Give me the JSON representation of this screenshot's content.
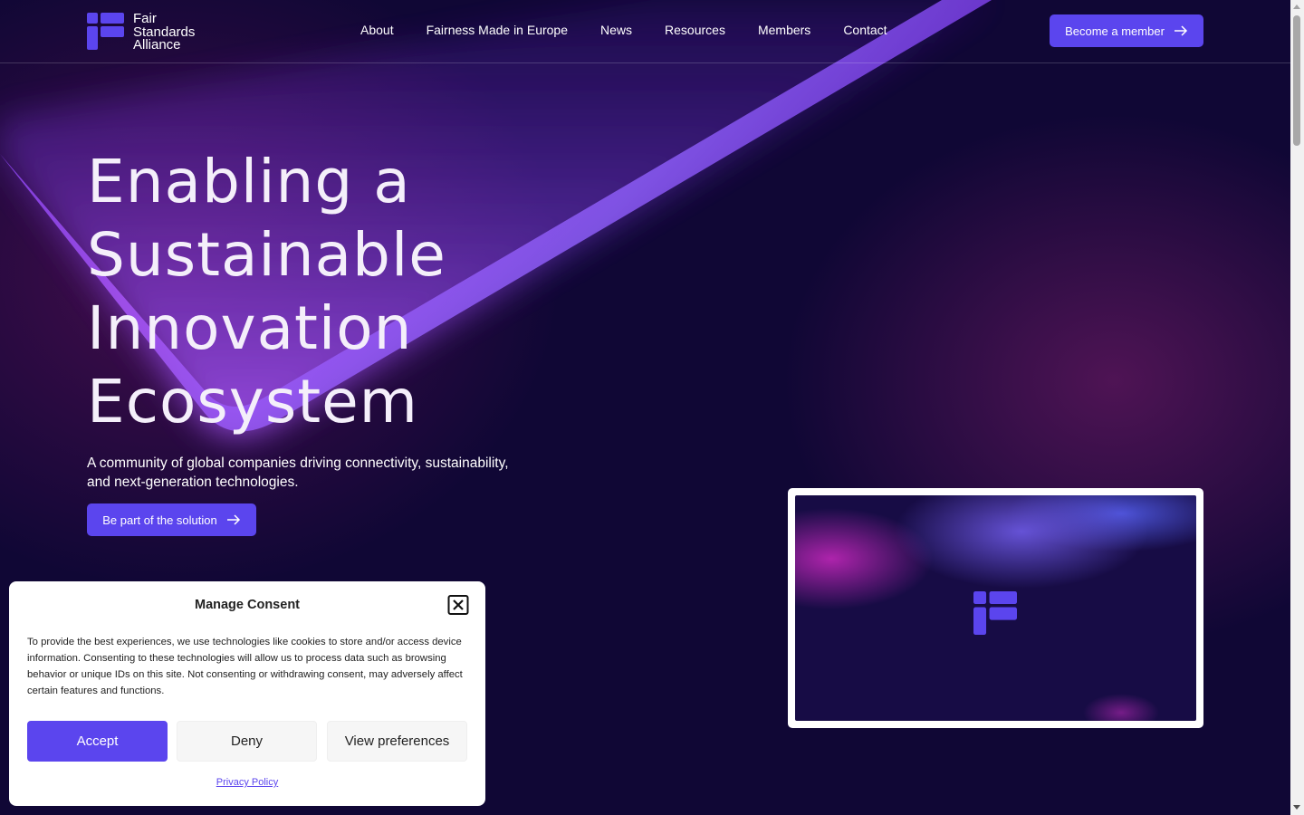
{
  "header": {
    "logo_lines": [
      "Fair",
      "Standards",
      "Alliance"
    ],
    "nav": [
      "About",
      "Fairness Made in Europe",
      "News",
      "Resources",
      "Members",
      "Contact"
    ],
    "cta_label": "Become a member"
  },
  "hero": {
    "title_lines": [
      "Enabling a",
      "Sustainable",
      "Innovation",
      "Ecosystem"
    ],
    "subtitle": "A community of global companies driving connectivity, sustainability, and next-generation technologies.",
    "cta_label": "Be part of the solution"
  },
  "consent": {
    "title": "Manage Consent",
    "text": "To provide the best experiences, we use technologies like cookies to store and/or access device information. Consenting to these technologies will allow us to process data such as browsing behavior or unique IDs on this site. Not consenting or withdrawing consent, may adversely affect certain features and functions.",
    "accept_label": "Accept",
    "deny_label": "Deny",
    "view_label": "View preferences",
    "privacy_label": "Privacy Policy"
  },
  "colors": {
    "background": "#100735",
    "accent": "#5b45ee",
    "beam": "#a855f7"
  }
}
